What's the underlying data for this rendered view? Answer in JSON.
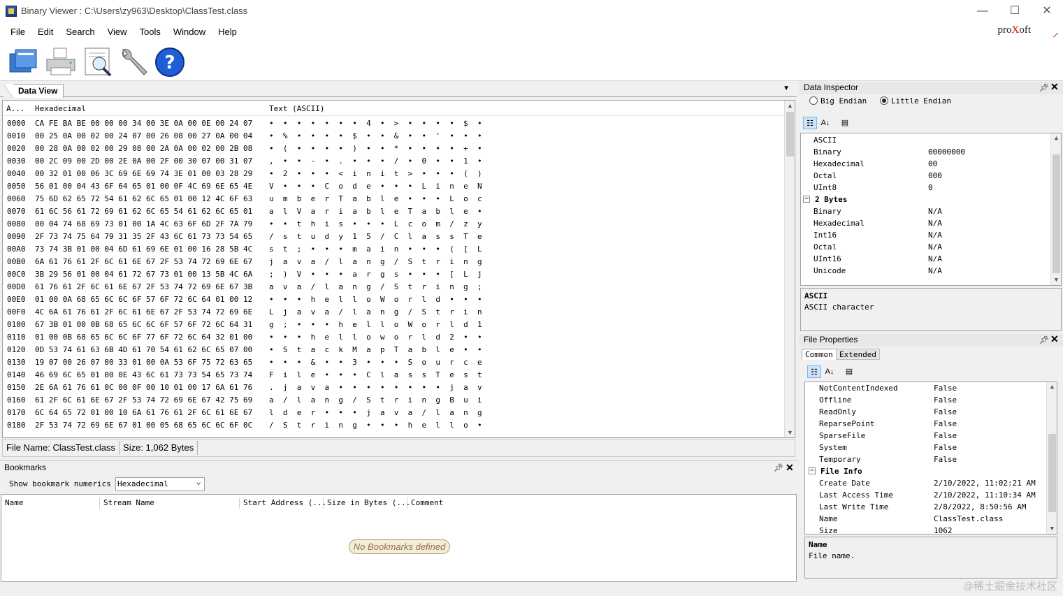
{
  "window": {
    "title": "Binary Viewer : C:\\Users\\zy963\\Desktop\\ClassTest.class",
    "minimize": "—",
    "maximize": "☐",
    "close": "✕"
  },
  "menu": [
    "File",
    "Edit",
    "Search",
    "View",
    "Tools",
    "Window",
    "Help"
  ],
  "brand": {
    "prefix": "pro",
    "x": "X",
    "suffix": "oft"
  },
  "toolbar": [
    {
      "name": "open-icon"
    },
    {
      "name": "print-icon"
    },
    {
      "name": "print-preview-icon"
    },
    {
      "name": "tools-wrench-icon"
    },
    {
      "name": "help-icon"
    }
  ],
  "data_view": {
    "tab_label": "Data View",
    "col_address": "A...",
    "col_hex": "Hexadecimal",
    "col_text": "Text (ASCII)",
    "rows": [
      {
        "addr": "0000",
        "hex": "CA FE BA BE 00 00 00 34 00 3E 0A 00 0E 00 24 07",
        "text": "•  •  •  •  •  •  •  4  •  >  •  •  •  •  $  •"
      },
      {
        "addr": "0010",
        "hex": "00 25 0A 00 02 00 24 07 00 26 08 00 27 0A 00 04",
        "text": "•  %  •  •  •  •  $  •  •  &  •  •  '  •  •  •"
      },
      {
        "addr": "0020",
        "hex": "00 28 0A 00 02 00 29 08 00 2A 0A 00 02 00 2B 08",
        "text": "•  (  •  •  •  •  )  •  •  *  •  •  •  •  +  •"
      },
      {
        "addr": "0030",
        "hex": "00 2C 09 00 2D 00 2E 0A 00 2F 00 30 07 00 31 07",
        "text": ",  •  •  -  •  .  •  •  •  /  •  0  •  •  1  •"
      },
      {
        "addr": "0040",
        "hex": "00 32 01 00 06 3C 69 6E 69 74 3E 01 00 03 28 29",
        "text": "•  2  •  •  •  <  i  n  i  t  >  •  •  •  (  )"
      },
      {
        "addr": "0050",
        "hex": "56 01 00 04 43 6F 64 65 01 00 0F 4C 69 6E 65 4E",
        "text": "V  •  •  •  C  o  d  e  •  •  •  L  i  n  e  N"
      },
      {
        "addr": "0060",
        "hex": "75 6D 62 65 72 54 61 62 6C 65 01 00 12 4C 6F 63",
        "text": "u  m  b  e  r  T  a  b  l  e  •  •  •  L  o  c"
      },
      {
        "addr": "0070",
        "hex": "61 6C 56 61 72 69 61 62 6C 65 54 61 62 6C 65 01",
        "text": "a  l  V  a  r  i  a  b  l  e  T  a  b  l  e  •"
      },
      {
        "addr": "0080",
        "hex": "00 04 74 68 69 73 01 00 1A 4C 63 6F 6D 2F 7A 79",
        "text": "•  •  t  h  i  s  •  •  •  L  c  o  m  /  z  y"
      },
      {
        "addr": "0090",
        "hex": "2F 73 74 75 64 79 31 35 2F 43 6C 61 73 73 54 65",
        "text": "/  s  t  u  d  y  1  5  /  C  l  a  s  s  T  e"
      },
      {
        "addr": "00A0",
        "hex": "73 74 3B 01 00 04 6D 61 69 6E 01 00 16 28 5B 4C",
        "text": "s  t  ;  •  •  •  m  a  i  n  •  •  •  (  [  L"
      },
      {
        "addr": "00B0",
        "hex": "6A 61 76 61 2F 6C 61 6E 67 2F 53 74 72 69 6E 67",
        "text": "j  a  v  a  /  l  a  n  g  /  S  t  r  i  n  g"
      },
      {
        "addr": "00C0",
        "hex": "3B 29 56 01 00 04 61 72 67 73 01 00 13 5B 4C 6A",
        "text": ";  )  V  •  •  •  a  r  g  s  •  •  •  [  L  j"
      },
      {
        "addr": "00D0",
        "hex": "61 76 61 2F 6C 61 6E 67 2F 53 74 72 69 6E 67 3B",
        "text": "a  v  a  /  l  a  n  g  /  S  t  r  i  n  g  ;"
      },
      {
        "addr": "00E0",
        "hex": "01 00 0A 68 65 6C 6C 6F 57 6F 72 6C 64 01 00 12",
        "text": "•  •  •  h  e  l  l  o  W  o  r  l  d  •  •  •"
      },
      {
        "addr": "00F0",
        "hex": "4C 6A 61 76 61 2F 6C 61 6E 67 2F 53 74 72 69 6E",
        "text": "L  j  a  v  a  /  l  a  n  g  /  S  t  r  i  n"
      },
      {
        "addr": "0100",
        "hex": "67 3B 01 00 0B 68 65 6C 6C 6F 57 6F 72 6C 64 31",
        "text": "g  ;  •  •  •  h  e  l  l  o  W  o  r  l  d  1"
      },
      {
        "addr": "0110",
        "hex": "01 00 0B 68 65 6C 6C 6F 77 6F 72 6C 64 32 01 00",
        "text": "•  •  •  h  e  l  l  o  w  o  r  l  d  2  •  •"
      },
      {
        "addr": "0120",
        "hex": "0D 53 74 61 63 6B 4D 61 70 54 61 62 6C 65 07 00",
        "text": "•  S  t  a  c  k  M  a  p  T  a  b  l  e  •  •"
      },
      {
        "addr": "0130",
        "hex": "19 07 00 26 07 00 33 01 00 0A 53 6F 75 72 63 65",
        "text": "•  •  •  &  •  •  3  •  •  •  S  o  u  r  c  e"
      },
      {
        "addr": "0140",
        "hex": "46 69 6C 65 01 00 0E 43 6C 61 73 73 54 65 73 74",
        "text": "F  i  l  e  •  •  •  C  l  a  s  s  T  e  s  t"
      },
      {
        "addr": "0150",
        "hex": "2E 6A 61 76 61 0C 00 0F 00 10 01 00 17 6A 61 76",
        "text": ".  j  a  v  a  •  •  •  •  •  •  •  •  j  a  v"
      },
      {
        "addr": "0160",
        "hex": "61 2F 6C 61 6E 67 2F 53 74 72 69 6E 67 42 75 69",
        "text": "a  /  l  a  n  g  /  S  t  r  i  n  g  B  u  i"
      },
      {
        "addr": "0170",
        "hex": "6C 64 65 72 01 00 10 6A 61 76 61 2F 6C 61 6E 67",
        "text": "l  d  e  r  •  •  •  j  a  v  a  /  l  a  n  g"
      },
      {
        "addr": "0180",
        "hex": "2F 53 74 72 69 6E 67 01 00 05 68 65 6C 6C 6F 0C",
        "text": "/  S  t  r  i  n  g  •  •  •  h  e  l  l  o  •"
      }
    ]
  },
  "status": {
    "file_name": "File Name: ClassTest.class",
    "size": "Size: 1,062 Bytes"
  },
  "bookmarks": {
    "title": "Bookmarks",
    "show_label": "Show bookmark numerics as",
    "show_value": "Hexadecimal",
    "columns": [
      "Name",
      "Stream Name",
      "Start Address (...",
      "Size in Bytes (...",
      "Comment"
    ],
    "empty": "No Bookmarks defined"
  },
  "data_inspector": {
    "title": "Data Inspector",
    "big_endian": "Big Endian",
    "little_endian": "Little Endian",
    "endian_selected": "little",
    "rows": [
      {
        "k": "ASCII",
        "v": "",
        "cat": false
      },
      {
        "k": "Binary",
        "v": "00000000",
        "cat": false
      },
      {
        "k": "Hexadecimal",
        "v": "00",
        "cat": false
      },
      {
        "k": "Octal",
        "v": "000",
        "cat": false
      },
      {
        "k": "UInt8",
        "v": "0",
        "cat": false
      },
      {
        "k": "2 Bytes",
        "v": "",
        "cat": true
      },
      {
        "k": "Binary",
        "v": "N/A",
        "cat": false
      },
      {
        "k": "Hexadecimal",
        "v": "N/A",
        "cat": false
      },
      {
        "k": "Int16",
        "v": "N/A",
        "cat": false
      },
      {
        "k": "Octal",
        "v": "N/A",
        "cat": false
      },
      {
        "k": "UInt16",
        "v": "N/A",
        "cat": false
      },
      {
        "k": "Unicode",
        "v": "N/A",
        "cat": false
      }
    ],
    "desc_title": "ASCII",
    "desc_text": "ASCII character"
  },
  "file_properties": {
    "title": "File Properties",
    "tab_common": "Common",
    "tab_extended": "Extended",
    "rows": [
      {
        "k": "NotContentIndexed",
        "v": "False",
        "cat": false
      },
      {
        "k": "Offline",
        "v": "False",
        "cat": false
      },
      {
        "k": "ReadOnly",
        "v": "False",
        "cat": false
      },
      {
        "k": "ReparsePoint",
        "v": "False",
        "cat": false
      },
      {
        "k": "SparseFile",
        "v": "False",
        "cat": false
      },
      {
        "k": "System",
        "v": "False",
        "cat": false
      },
      {
        "k": "Temporary",
        "v": "False",
        "cat": false
      },
      {
        "k": "File Info",
        "v": "",
        "cat": true
      },
      {
        "k": "Create Date",
        "v": "2/10/2022, 11:02:21 AM",
        "cat": false
      },
      {
        "k": "Last Access Time",
        "v": "2/10/2022, 11:10:34 AM",
        "cat": false
      },
      {
        "k": "Last Write Time",
        "v": "2/8/2022, 8:50:56 AM",
        "cat": false
      },
      {
        "k": "Name",
        "v": "ClassTest.class",
        "cat": false
      },
      {
        "k": "Size",
        "v": "1062",
        "cat": false
      }
    ],
    "desc_title": "Name",
    "desc_text": "File name."
  },
  "watermark": "@稀土掘金技术社区"
}
